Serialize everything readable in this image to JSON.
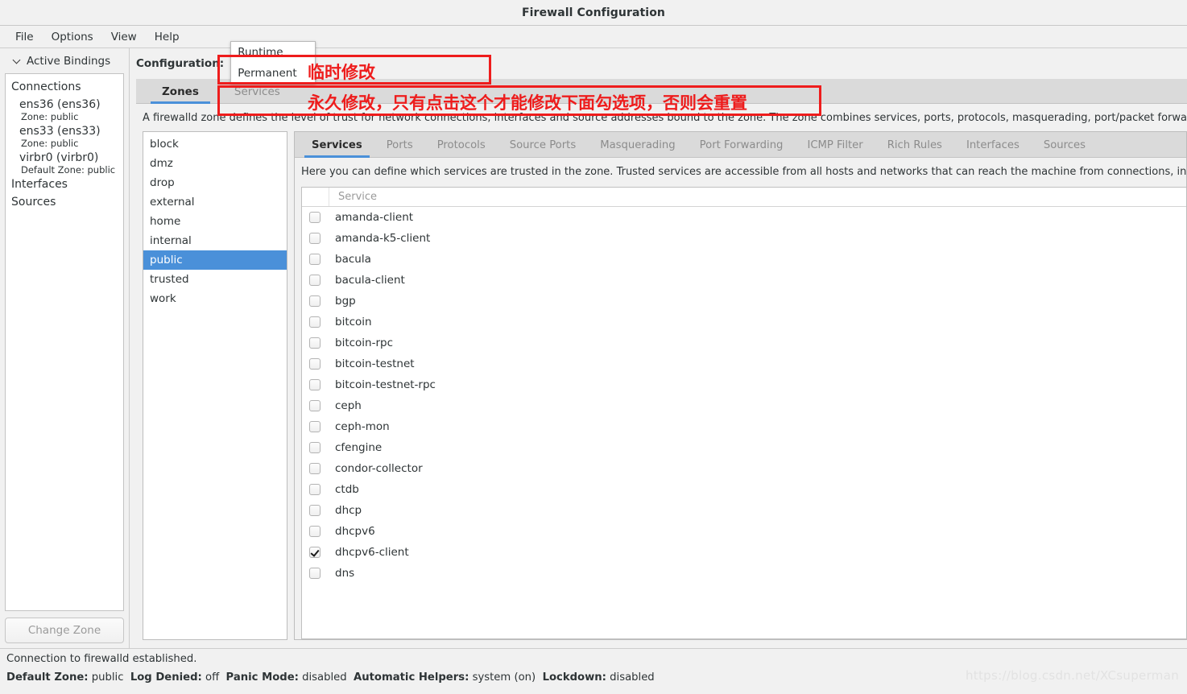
{
  "window": {
    "title": "Firewall Configuration"
  },
  "menubar": {
    "items": [
      "File",
      "Options",
      "View",
      "Help"
    ]
  },
  "sidebar": {
    "bindings_header": "Active Bindings",
    "groups": [
      {
        "label": "Connections"
      },
      {
        "label": "Interfaces"
      },
      {
        "label": "Sources"
      }
    ],
    "connections": [
      {
        "name": "ens36 (ens36)",
        "zone": "Zone: public"
      },
      {
        "name": "ens33 (ens33)",
        "zone": "Zone: public"
      },
      {
        "name": "virbr0 (virbr0)",
        "zone": "Default Zone: public"
      }
    ],
    "change_zone_label": "Change Zone"
  },
  "config": {
    "label": "Configuration:",
    "selected": "Runtime",
    "options": [
      "Runtime",
      "Permanent"
    ]
  },
  "top_tabs": [
    {
      "label": "Zones",
      "active": true
    },
    {
      "label": "Services",
      "active": false
    }
  ],
  "zone_description": "A firewalld zone defines the level of trust for network connections, interfaces and source addresses bound to the zone. The zone combines services, ports, protocols, masquerading, port/packet forwarding, icmp filters and rich rules. The zone can be bound to interfaces and source addresses.",
  "zones": {
    "items": [
      "block",
      "dmz",
      "drop",
      "external",
      "home",
      "internal",
      "public",
      "trusted",
      "work"
    ],
    "selected": "public"
  },
  "inner_tabs": [
    {
      "label": "Services",
      "active": true
    },
    {
      "label": "Ports",
      "active": false
    },
    {
      "label": "Protocols",
      "active": false
    },
    {
      "label": "Source Ports",
      "active": false
    },
    {
      "label": "Masquerading",
      "active": false
    },
    {
      "label": "Port Forwarding",
      "active": false
    },
    {
      "label": "ICMP Filter",
      "active": false
    },
    {
      "label": "Rich Rules",
      "active": false
    },
    {
      "label": "Interfaces",
      "active": false
    },
    {
      "label": "Sources",
      "active": false
    }
  ],
  "services_description": "Here you can define which services are trusted in the zone. Trusted services are accessible from all hosts and networks that can reach the machine from connections, interfaces and sources bound to this zone.",
  "services_table": {
    "column_header": "Service",
    "rows": [
      {
        "name": "amanda-client",
        "checked": false
      },
      {
        "name": "amanda-k5-client",
        "checked": false
      },
      {
        "name": "bacula",
        "checked": false
      },
      {
        "name": "bacula-client",
        "checked": false
      },
      {
        "name": "bgp",
        "checked": false
      },
      {
        "name": "bitcoin",
        "checked": false
      },
      {
        "name": "bitcoin-rpc",
        "checked": false
      },
      {
        "name": "bitcoin-testnet",
        "checked": false
      },
      {
        "name": "bitcoin-testnet-rpc",
        "checked": false
      },
      {
        "name": "ceph",
        "checked": false
      },
      {
        "name": "ceph-mon",
        "checked": false
      },
      {
        "name": "cfengine",
        "checked": false
      },
      {
        "name": "condor-collector",
        "checked": false
      },
      {
        "name": "ctdb",
        "checked": false
      },
      {
        "name": "dhcp",
        "checked": false
      },
      {
        "name": "dhcpv6",
        "checked": false
      },
      {
        "name": "dhcpv6-client",
        "checked": true
      },
      {
        "name": "dns",
        "checked": false
      }
    ]
  },
  "statusbar": {
    "connection_message": "Connection to firewalld established.",
    "fields": [
      {
        "label": "Default Zone:",
        "value": "public"
      },
      {
        "label": "Log Denied:",
        "value": "off"
      },
      {
        "label": "Panic Mode:",
        "value": "disabled"
      },
      {
        "label": "Automatic Helpers:",
        "value": "system (on)"
      },
      {
        "label": "Lockdown:",
        "value": "disabled"
      }
    ],
    "watermark": "https://blog.csdn.net/XCsuperman"
  },
  "annotations": {
    "color": "#ee1c1c",
    "runtime_note": "临时修改",
    "permanent_note": "永久修改，只有点击这个才能修改下面勾选项，否则会重置"
  }
}
